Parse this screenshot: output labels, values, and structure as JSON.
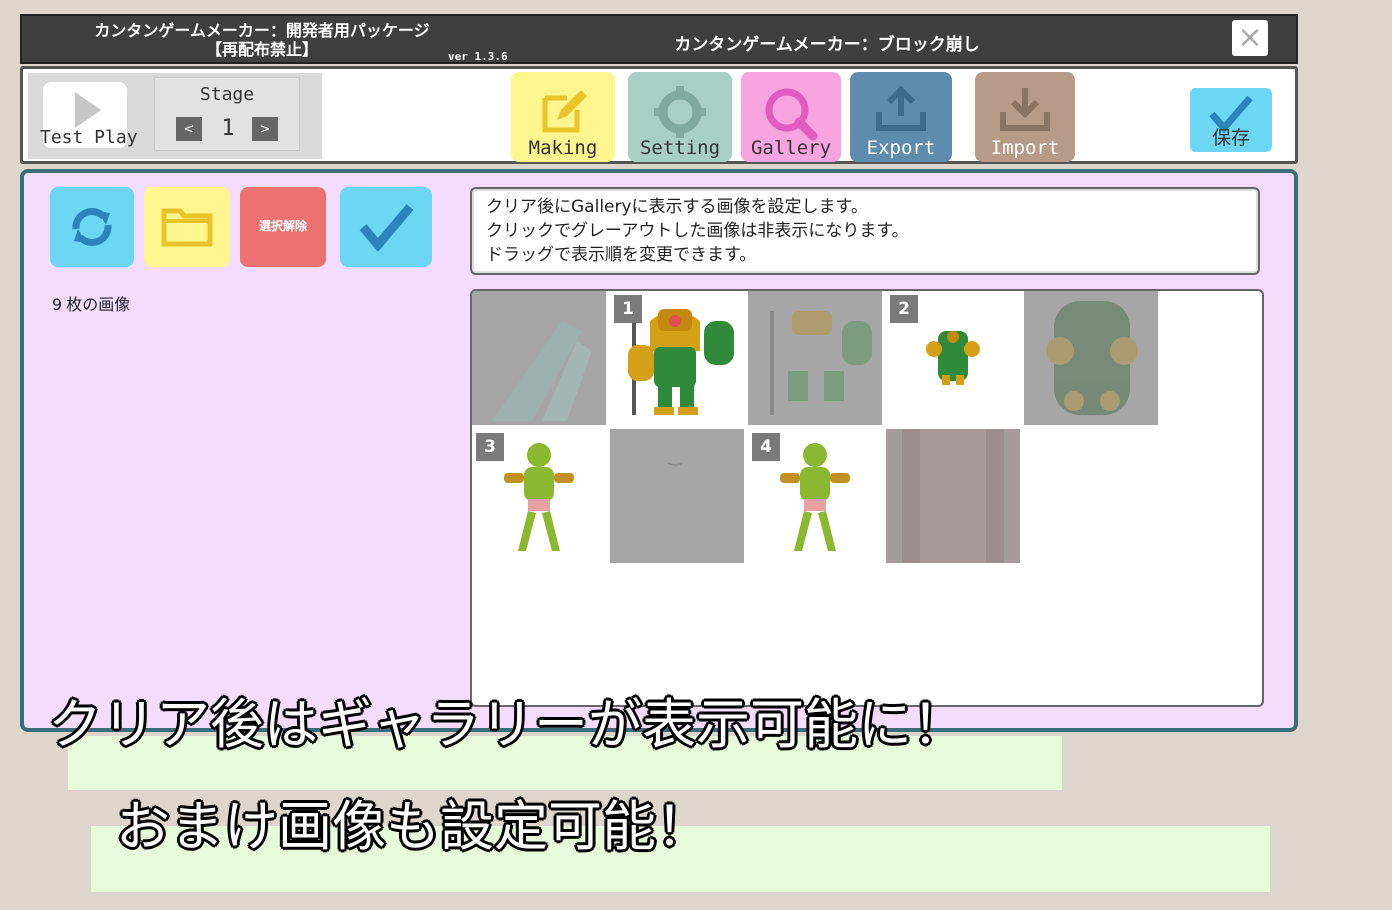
{
  "window": {
    "title_left_line1": "カンタンゲームメーカー：開発者用パッケージ",
    "title_left_line2": "【再配布禁止】",
    "version": "ver 1.3.6",
    "title_center": "カンタンゲームメーカー：ブロック崩し",
    "close_label": "×"
  },
  "toolbar": {
    "test_play_label": "Test Play",
    "stage_label": "Stage",
    "stage_prev": "<",
    "stage_value": "1",
    "stage_next": ">",
    "modes": [
      {
        "label": "Making",
        "color": "#fff58f"
      },
      {
        "label": "Setting",
        "color": "#a8cfc4"
      },
      {
        "label": "Gallery",
        "color": "#f8a4e0"
      },
      {
        "label": "Export",
        "color": "#5e8cad"
      },
      {
        "label": "Import",
        "color": "#b89a88"
      }
    ],
    "save_label": "保存"
  },
  "panel": {
    "deselect_label": "選択解除",
    "count_value": "9",
    "count_label": "枚の画像",
    "info_lines": [
      "クリア後にGalleryに表示する画像を設定します。",
      "クリックでグレーアウトした画像は非表示になります。",
      "ドラッグで表示順を変更できます。"
    ]
  },
  "gallery": {
    "items": [
      {
        "badge": "",
        "state": "hidden"
      },
      {
        "badge": "1",
        "state": "visible"
      },
      {
        "badge": "",
        "state": "hidden"
      },
      {
        "badge": "2",
        "state": "visible"
      },
      {
        "badge": "",
        "state": "hidden"
      },
      {
        "badge": "3",
        "state": "visible"
      },
      {
        "badge": "",
        "state": "hidden"
      },
      {
        "badge": "4",
        "state": "visible"
      },
      {
        "badge": "",
        "state": "hidden"
      }
    ]
  },
  "captions": {
    "line1": "クリア後はギャラリーが表示可能に！",
    "line2": "おまけ画像も設定可能！"
  }
}
